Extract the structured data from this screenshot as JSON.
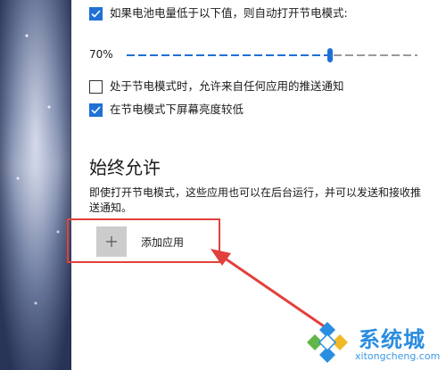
{
  "battery_saver": {
    "auto_on": {
      "label": "如果电池电量低于以下值，则自动打开节电模式:",
      "checked": true
    },
    "threshold": {
      "value_text": "70%",
      "value": 0.7
    },
    "allow_push": {
      "label": "处于节电模式时，允许来自任何应用的推送通知",
      "checked": false
    },
    "lower_brightness": {
      "label": "在节电模式下屏幕亮度较低",
      "checked": true
    }
  },
  "always_allowed": {
    "title": "始终允许",
    "description": "即使打开节电模式，这些应用也可以在后台运行，并可以发送和接收推送通知。",
    "add_app_label": "添加应用",
    "add_icon": "plus-icon"
  },
  "annotation": {
    "highlight_color": "#e2403b",
    "arrow_color": "#e2403b"
  },
  "watermark": {
    "name": "系统城",
    "url": "xitongcheng.com",
    "logo_icon": "diamond-logo-icon",
    "color": "#2a8de0"
  },
  "colors": {
    "accent": "#2170d6",
    "plus_box": "#cccccc"
  }
}
